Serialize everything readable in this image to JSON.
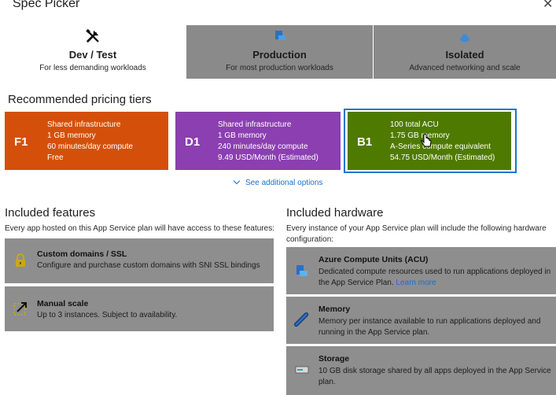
{
  "header": {
    "title": "Spec Picker",
    "close_glyph": "✕"
  },
  "tabs": [
    {
      "name": "Dev / Test",
      "desc": "For less demanding workloads",
      "icon": "tools-icon",
      "selected": true
    },
    {
      "name": "Production",
      "desc": "For most production workloads",
      "icon": "server-icon",
      "selected": false
    },
    {
      "name": "Isolated",
      "desc": "Advanced networking and scale",
      "icon": "cloud-icon",
      "selected": false
    }
  ],
  "recommended": {
    "heading": "Recommended pricing tiers",
    "tiers": [
      {
        "code": "F1",
        "color": "#d4500a",
        "lines": [
          "Shared infrastructure",
          "1 GB memory",
          "60 minutes/day compute",
          "Free"
        ]
      },
      {
        "code": "D1",
        "color": "#8b3fb0",
        "lines": [
          "Shared infrastructure",
          "1 GB memory",
          "240 minutes/day compute",
          "9.49 USD/Month (Estimated)"
        ]
      },
      {
        "code": "B1",
        "color": "#4f7a00",
        "selected": true,
        "lines": [
          "100 total ACU",
          "1.75 GB memory",
          "A-Series compute equivalent",
          "54.75 USD/Month (Estimated)"
        ]
      }
    ],
    "more_link": "See additional options"
  },
  "features": {
    "heading": "Included features",
    "intro": "Every app hosted on this App Service plan will have access to these features:",
    "items": [
      {
        "title": "Custom domains / SSL",
        "desc": "Configure and purchase custom domains with SNI SSL bindings",
        "icon": "globe-lock-icon"
      },
      {
        "title": "Manual scale",
        "desc": "Up to 3 instances. Subject to availability.",
        "icon": "scale-icon"
      }
    ]
  },
  "hardware": {
    "heading": "Included hardware",
    "intro_line1": "Every instance of your App Service plan will include the following hardware",
    "intro_line2": "configuration:",
    "items": [
      {
        "title": "Azure Compute Units (ACU)",
        "desc_line1": "Dedicated compute resources used to run applications deployed in",
        "desc_line2": "the App Service Plan.",
        "link": "Learn more",
        "icon": "compute-icon"
      },
      {
        "title": "Memory",
        "desc_line1": "Memory per instance available to run applications deployed and",
        "desc_line2": "running in the App Service plan.",
        "icon": "memory-icon"
      },
      {
        "title": "Storage",
        "desc_line1": "10 GB disk storage shared by all apps deployed in the App Service",
        "desc_line2": "plan.",
        "icon": "storage-icon"
      }
    ]
  },
  "colors": {
    "accent": "#1a6fd0",
    "selected_border": "#1877c8",
    "card_gray": "#8e8e8e",
    "tab_gray": "#8a8a8a"
  }
}
